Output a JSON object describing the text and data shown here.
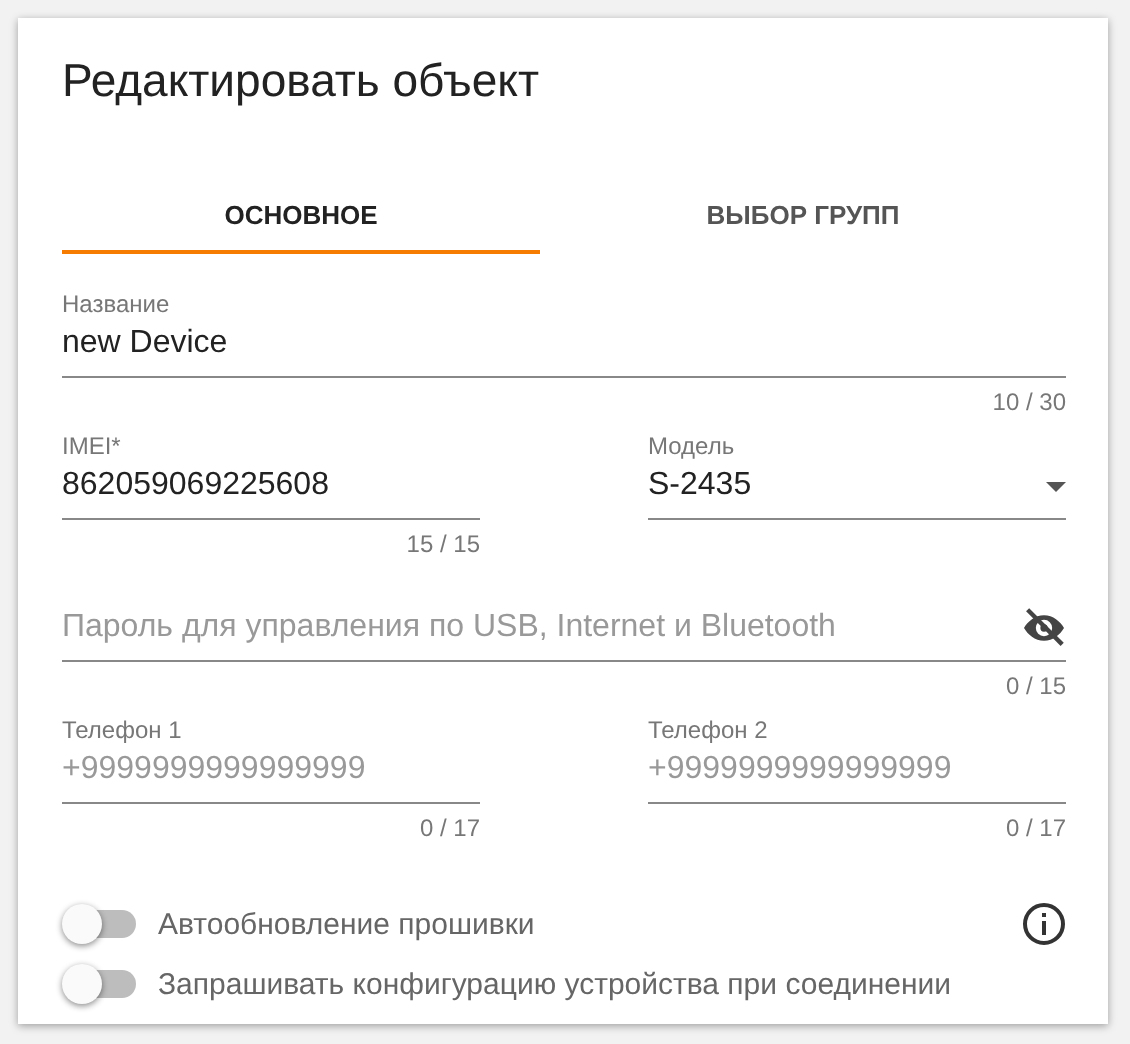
{
  "dialog": {
    "title": "Редактировать объект"
  },
  "tabs": [
    {
      "label": "ОСНОВНОЕ",
      "selected": true
    },
    {
      "label": "ВЫБОР ГРУПП",
      "selected": false
    }
  ],
  "form_rows": [
    [
      {
        "kind": "text",
        "label": "Название",
        "value": "new Device",
        "counter": "10 / 30"
      }
    ],
    [
      {
        "kind": "text",
        "label": "IMEI*",
        "value": "862059069225608",
        "counter": "15 / 15"
      },
      {
        "kind": "select",
        "label": "Модель",
        "value": "S-2435"
      }
    ],
    [
      {
        "kind": "password",
        "placeholder": "Пароль для управления по USB, Internet и Bluetooth",
        "counter": "0 / 15"
      }
    ],
    [
      {
        "kind": "text",
        "label": "Телефон 1",
        "placeholder": "+9999999999999999",
        "counter": "0 / 17"
      },
      {
        "kind": "text",
        "label": "Телефон 2",
        "placeholder": "+9999999999999999",
        "counter": "0 / 17"
      }
    ]
  ],
  "toggles": [
    {
      "label": "Автообновление прошивки",
      "on": false,
      "has_info": true
    },
    {
      "label": "Запрашивать конфигурацию устройства при соединении",
      "on": false,
      "has_info": false
    }
  ]
}
